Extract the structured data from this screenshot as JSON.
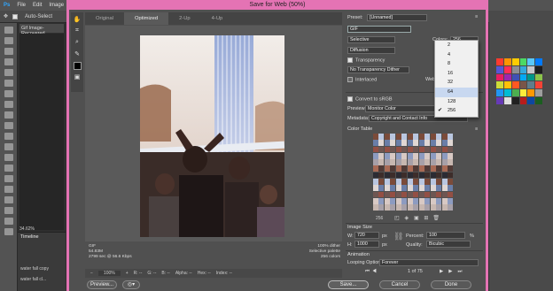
{
  "ps": {
    "menu": [
      "File",
      "Edit",
      "Image"
    ],
    "auto_select": "Auto-Select",
    "doc_tab": "Gif Image-Recovered",
    "zoom": "34.62%",
    "timeline_label": "Timeline",
    "layer_label": "water fall copy",
    "layer_label2": "water fall cl..."
  },
  "dialog": {
    "title": "Save for Web (50%)",
    "tabs": [
      "Original",
      "Optimized",
      "2-Up",
      "4-Up"
    ],
    "active_tab": 1,
    "info_left": [
      "GIF",
      "54.83M",
      "2799 sec @ 56.6 Kbps"
    ],
    "info_right": [
      "100% dither",
      "Selective palette",
      "256 colors"
    ],
    "status": {
      "zoom": "100%",
      "r": "R: --",
      "g": "G: --",
      "b": "B: --",
      "alpha": "Alpha: --",
      "hex": "Hex: --",
      "index": "Index: --"
    },
    "buttons": {
      "preview": "Preview...",
      "save": "Save...",
      "cancel": "Cancel",
      "done": "Done"
    }
  },
  "settings": {
    "preset_label": "Preset:",
    "preset_value": "[Unnamed]",
    "format": "GIF",
    "reduction": "Selective",
    "dither_algo": "Diffusion",
    "transparency_label": "Transparency",
    "transparency_checked": true,
    "matte_dither": "No Transparency Dither",
    "interlaced_label": "Interlaced",
    "interlaced_checked": false,
    "web_snap_label": "Web",
    "colors_label": "Colors:",
    "colors_value": "256",
    "convert_srgb": "Convert to sRGB",
    "convert_checked": true,
    "preview_label": "Preview:",
    "preview_value": "Monitor Color",
    "metadata_label": "Metadata:",
    "metadata_value": "Copyright and Contact Info",
    "color_table_label": "Color Table",
    "color_count": "256",
    "image_size_label": "Image Size",
    "w_label": "W:",
    "w_value": "720",
    "h_label": "H:",
    "h_value": "1000",
    "px": "px",
    "percent_label": "Percent:",
    "percent_value": "100",
    "percent_unit": "%",
    "quality_label": "Quality:",
    "quality_value": "Bicubic",
    "animation_label": "Animation",
    "looping_label": "Looping Options:",
    "looping_value": "Forever",
    "frame_counter": "1 of 75"
  },
  "colors_dropdown": {
    "options": [
      "2",
      "4",
      "8",
      "16",
      "32",
      "64",
      "128",
      "256"
    ],
    "highlighted": "64",
    "checked": "256"
  },
  "palette": [
    "#7b4b3a",
    "#a86a55",
    "#d8c9c4",
    "#6a7ea8",
    "#2b2b33",
    "#c7b7b0",
    "#934f44",
    "#b9c6e0",
    "#503a36",
    "#8d9bc0",
    "#e0d7d4",
    "#3d2d2a",
    "#a7a0a8",
    "#6e5652"
  ]
}
